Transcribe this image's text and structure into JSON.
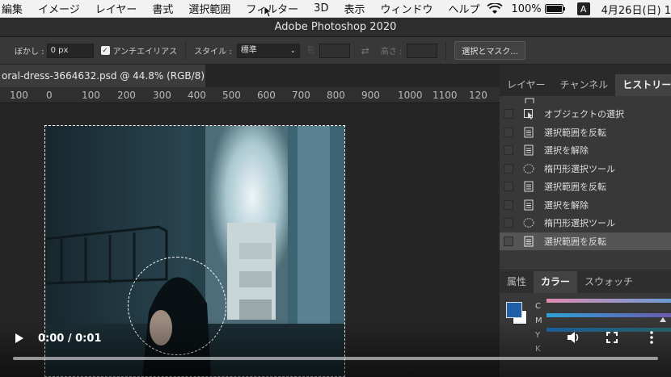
{
  "menubar": {
    "items": [
      "編集",
      "イメージ",
      "レイヤー",
      "書式",
      "選択範囲",
      "フィルター",
      "3D",
      "表示",
      "ウィンドウ",
      "ヘルプ"
    ],
    "battery": "100%",
    "input_badge": "A",
    "date": "4月26日(日) 1"
  },
  "window": {
    "title": "Adobe Photoshop 2020"
  },
  "options": {
    "feather_label": "ぼかし :",
    "feather_value": "0 px",
    "antialias_label": "アンチエイリアス",
    "style_label": "スタイル :",
    "style_value": "標準",
    "height_label": "高さ :",
    "select_mask_button": "選択とマスク..."
  },
  "document": {
    "tab_title": "oral-dress-3664632.psd @ 44.8% (RGB/8) *"
  },
  "ruler": {
    "ticks": [
      "100",
      "0",
      "100",
      "200",
      "300",
      "400",
      "500",
      "600",
      "700",
      "800",
      "900",
      "1000",
      "1100",
      "120"
    ]
  },
  "panels": {
    "top_tabs": [
      "レイヤー",
      "チャンネル",
      "ヒストリー"
    ],
    "history_items": [
      {
        "label": "オブジェクトの選択",
        "icon": "object-select-icon"
      },
      {
        "label": "選択範囲を反転",
        "icon": "document-icon"
      },
      {
        "label": "選択を解除",
        "icon": "document-icon"
      },
      {
        "label": "楕円形選択ツール",
        "icon": "ellipse-marquee-icon"
      },
      {
        "label": "選択範囲を反転",
        "icon": "document-icon"
      },
      {
        "label": "選択を解除",
        "icon": "document-icon"
      },
      {
        "label": "楕円形選択ツール",
        "icon": "ellipse-marquee-icon"
      },
      {
        "label": "選択範囲を反転",
        "icon": "document-icon"
      }
    ],
    "bottom_tabs": [
      "属性",
      "カラー",
      "スウォッチ"
    ],
    "color_sliders": [
      "C",
      "M",
      "Y",
      "K"
    ],
    "foreground_color": "#1f5fa8"
  },
  "video": {
    "time": "0:00 / 0:01"
  }
}
